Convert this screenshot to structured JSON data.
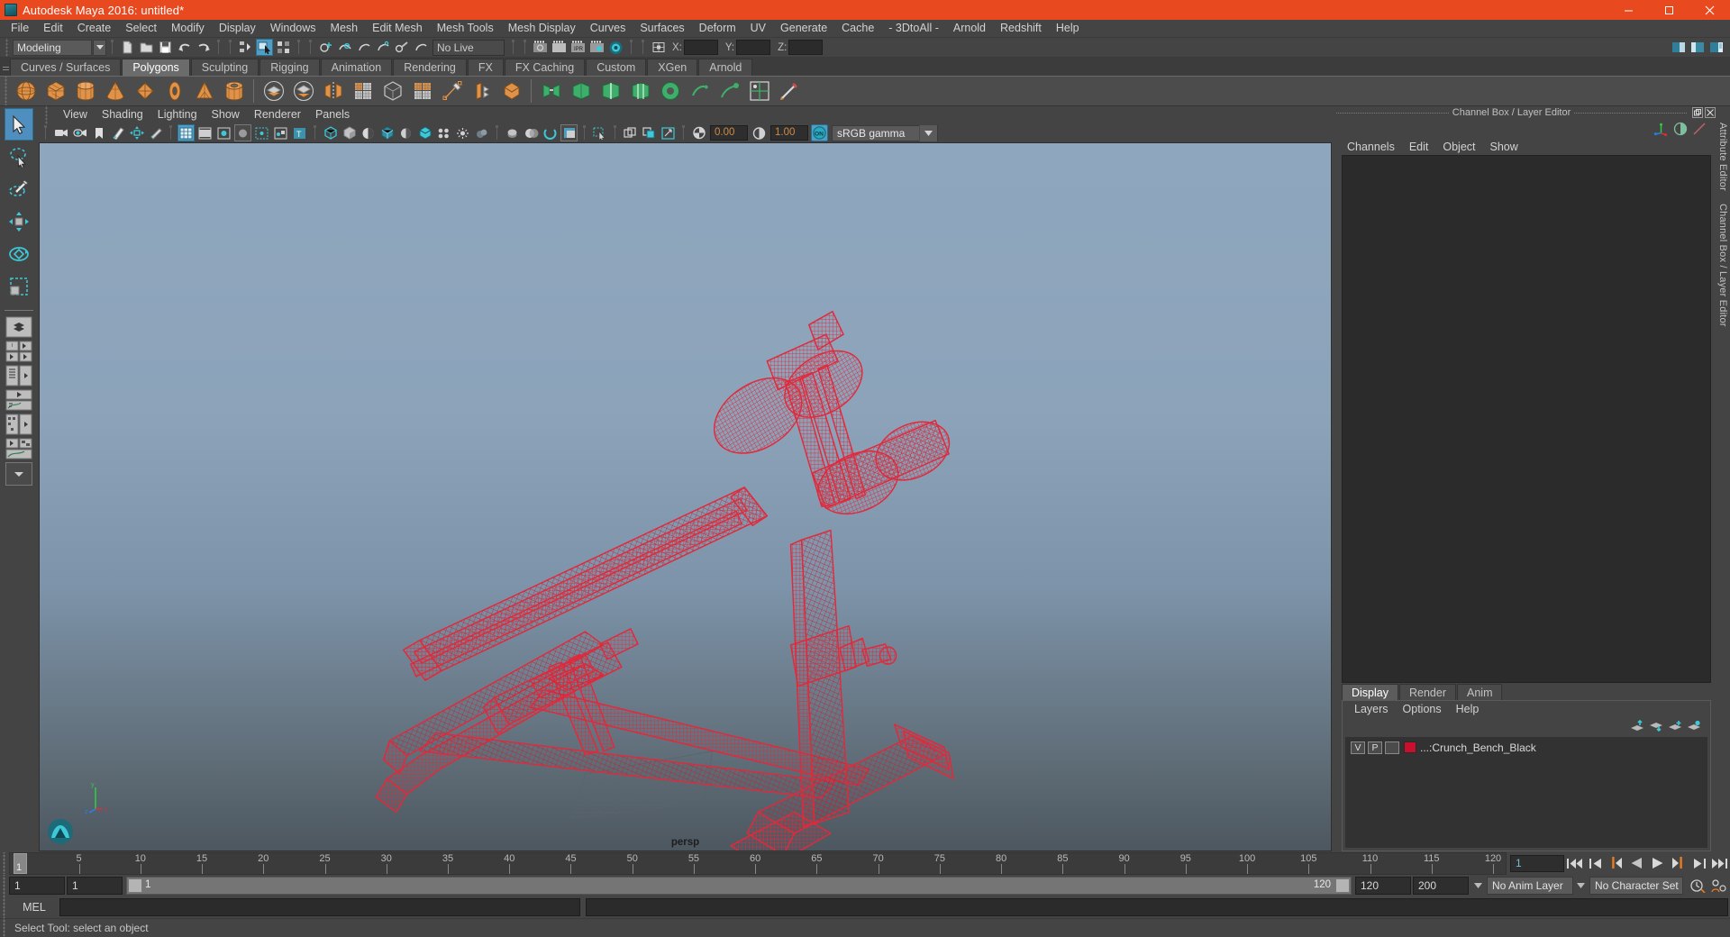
{
  "window": {
    "title": "Autodesk Maya 2016: untitled*",
    "app_icon": "maya-logo-icon",
    "controls": [
      {
        "name": "minimize-button",
        "glyph": "minimize-icon"
      },
      {
        "name": "maximize-button",
        "glyph": "maximize-icon"
      },
      {
        "name": "close-button",
        "glyph": "close-icon"
      }
    ],
    "accent_color": "#e8491f"
  },
  "menubar": {
    "items": [
      "File",
      "Edit",
      "Create",
      "Select",
      "Modify",
      "Display",
      "Windows",
      "Mesh",
      "Edit Mesh",
      "Mesh Tools",
      "Mesh Display",
      "Curves",
      "Surfaces",
      "Deform",
      "UV",
      "Generate",
      "Cache",
      "- 3DtoAll -",
      "Arnold",
      "Redshift",
      "Help"
    ]
  },
  "statusbar": {
    "mode": "Modeling",
    "live_surface": "No Live Surface",
    "coord_labels": [
      "X:",
      "Y:",
      "Z:"
    ],
    "coord_values": [
      "",
      "",
      ""
    ],
    "icons": [
      "new-scene-icon",
      "open-scene-icon",
      "save-scene-icon",
      "undo-icon",
      "redo-icon",
      "select-hierarchy-icon",
      "select-object-icon",
      "select-component-icon",
      "snap-to-grid-icon",
      "snap-to-curve-icon",
      "snap-to-point-icon",
      "snap-to-projected-center-icon",
      "snap-to-view-plane-icon",
      "make-live-icon",
      "render-view-icon",
      "render-sequence-icon",
      "ipr-render-icon",
      "render-settings-icon",
      "hypershade-icon",
      "input-connection-icon",
      "output-connection-icon",
      "sidebar-attribute-editor-icon",
      "sidebar-tool-settings-icon",
      "sidebar-channel-box-icon"
    ]
  },
  "shelf": {
    "tabs": [
      "Curves / Surfaces",
      "Polygons",
      "Sculpting",
      "Rigging",
      "Animation",
      "Rendering",
      "FX",
      "FX Caching",
      "Custom",
      "XGen",
      "Arnold"
    ],
    "active_tab": "Polygons",
    "buttons": [
      "poly-sphere-icon",
      "poly-cube-icon",
      "poly-cylinder-icon",
      "poly-cone-icon",
      "poly-plane-icon",
      "poly-torus-icon",
      "poly-pyramid-icon",
      "poly-pipe-icon",
      "combine-icon",
      "separate-icon",
      "mirror-geometry-icon",
      "smooth-icon",
      "boolean-icon",
      "extract-icon",
      "multi-cut-icon",
      "extrude-icon",
      "bevel-icon",
      "bridge-icon",
      "append-polygon-icon",
      "insert-edge-loop-icon",
      "offset-edge-loop-icon",
      "fill-hole-icon",
      "target-weld-icon",
      "sculpt-geometry-icon",
      "uv-editor-icon",
      "paint-select-icon"
    ]
  },
  "toolbox": {
    "tools": [
      {
        "name": "select-tool",
        "active": true
      },
      {
        "name": "lasso-select-tool",
        "active": false
      },
      {
        "name": "paint-select-tool",
        "active": false
      },
      {
        "name": "move-tool",
        "active": false
      },
      {
        "name": "rotate-tool",
        "active": false
      },
      {
        "name": "scale-tool",
        "active": false
      }
    ],
    "layout_presets": [
      "single-perspective-layout-icon",
      "four-view-layout-icon",
      "outliner-persp-layout-icon",
      "hypergraph-persp-layout-icon",
      "persp-graph-editor-layout-icon",
      "outliner-graph-layout-icon",
      "more-layouts-icon"
    ]
  },
  "viewport": {
    "menus": [
      "View",
      "Shading",
      "Lighting",
      "Show",
      "Renderer",
      "Panels"
    ],
    "camera_label": "persp",
    "exposure_value": "0.00",
    "gamma_value": "1.00",
    "color_management": "sRGB gamma",
    "color_management_toggle": "ON",
    "toolbar_icons": [
      "select-camera-icon",
      "camera-attributes-icon",
      "bookmark-icon",
      "image-plane-icon",
      "two-d-pan-zoom-icon",
      "grease-pencil-icon",
      "grid-toggle-icon",
      "film-gate-icon",
      "resolution-gate-icon",
      "gate-mask-icon",
      "film-origin-icon",
      "xray-icon",
      "xray-joints-icon",
      "wireframe-icon",
      "smooth-shade-icon",
      "shaded-wireframe-icon",
      "textures-icon",
      "lights-icon",
      "shadows-icon",
      "screen-space-ao-icon",
      "motion-blur-icon",
      "multisample-icon",
      "depth-of-field-icon",
      "isolate-select-icon",
      "x-ray-display-icon",
      "exposure-icon",
      "gamma-icon"
    ],
    "object_label": "Crunch_Bench_Black",
    "wireframe_color": "#e02a3c",
    "bg_top_color": "#8ea6bd",
    "bg_bottom_color": "#4e5860"
  },
  "channel_box_panel": {
    "title": "Channel Box / Layer Editor",
    "menus": [
      "Channels",
      "Edit",
      "Object",
      "Show"
    ],
    "titlebar_buttons": [
      "undock-icon",
      "close-icon"
    ],
    "header_icons": [
      "show-manipulators-icon",
      "toggle-channel-box-icon",
      "toggle-attribute-editor-icon"
    ]
  },
  "layer_editor": {
    "tabs": [
      "Display",
      "Render",
      "Anim"
    ],
    "active_tab": "Display",
    "menus": [
      "Layers",
      "Options",
      "Help"
    ],
    "tool_icons": [
      "move-layer-up-icon",
      "move-layer-down-icon",
      "new-layer-icon",
      "new-layer-from-selected-icon"
    ],
    "layers": [
      {
        "visibility": "V",
        "playback": "P",
        "state": "",
        "color": "#c8102e",
        "name": "...:Crunch_Bench_Black"
      }
    ]
  },
  "dock_strip": {
    "labels": [
      "Attribute Editor",
      "Channel Box / Layer Editor"
    ]
  },
  "timeline": {
    "ticks": [
      5,
      10,
      15,
      20,
      25,
      30,
      35,
      40,
      45,
      50,
      55,
      60,
      65,
      70,
      75,
      80,
      85,
      90,
      95,
      100,
      105,
      110,
      115,
      120
    ],
    "start_frame": "1",
    "current_frame": "1",
    "current_frame_field": "1",
    "range_start": "1",
    "range_end": "120",
    "anim_end": "120",
    "playback_end": "200",
    "range_slider_label": "1",
    "range_slider_end_label": "120",
    "anim_layer": "No Anim Layer",
    "character_set": "No Character Set",
    "playback_buttons": [
      "go-to-start-icon",
      "step-back-frame-icon",
      "step-back-key-icon",
      "play-backwards-icon",
      "play-forwards-icon",
      "step-forward-key-icon",
      "step-forward-frame-icon",
      "go-to-end-icon"
    ],
    "right_icons": [
      "animation-preferences-icon",
      "animation-settings-icon"
    ]
  },
  "command_line": {
    "language_label": "MEL",
    "input_value": "",
    "output_value": ""
  },
  "status_line": {
    "help_text": "Select Tool: select an object"
  }
}
